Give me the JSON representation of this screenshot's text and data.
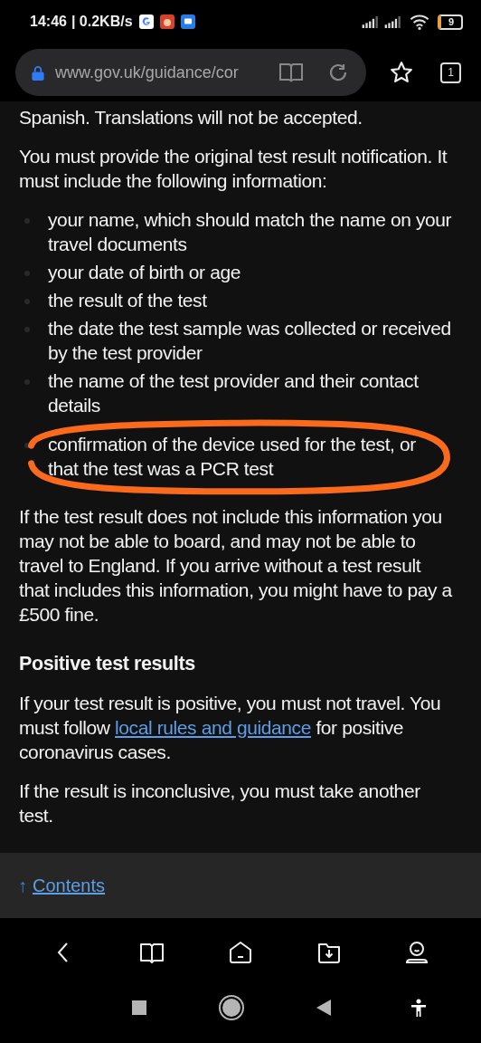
{
  "status_bar": {
    "time": "14:46",
    "speed": "| 0.2KB/s",
    "battery": "9"
  },
  "browser": {
    "url": "www.gov.uk/guidance/cor",
    "tab_count": "1"
  },
  "content": [
    {
      "kind": "paragraph",
      "text": "Spanish. Translations will not be accepted."
    },
    {
      "kind": "paragraph",
      "text": "You must provide the original test result notification. It must include the following information:"
    },
    {
      "kind": "list",
      "items": [
        {
          "text": "your name, which should match the name on your travel documents",
          "circled": false
        },
        {
          "text": "your date of birth or age",
          "circled": false
        },
        {
          "text": "the result of the test",
          "circled": false
        },
        {
          "text": "the date the test sample was collected or received by the test provider",
          "circled": false
        },
        {
          "text": "the name of the test provider and their contact details",
          "circled": false
        },
        {
          "text": "confirmation of the device used for the test, or that the test was a PCR test",
          "circled": true
        }
      ]
    },
    {
      "kind": "paragraph",
      "text": "If the test result does not include this information you may not be able to board, and may not be able to travel to England. If you arrive without a test result that includes this information, you might have to pay a £500 fine."
    },
    {
      "kind": "heading",
      "text": "Positive test results"
    },
    {
      "kind": "linked_paragraph",
      "parts": [
        {
          "text": "If your test result is positive, you must not travel. You must follow ",
          "link": false
        },
        {
          "text": "local rules and guidance",
          "link": true
        },
        {
          "text": " for positive coronavirus cases.",
          "link": false
        }
      ]
    },
    {
      "kind": "paragraph",
      "text": "If the result is inconclusive, you must take another test."
    }
  ],
  "contents_link": {
    "arrow": "↑",
    "label": "Contents"
  }
}
